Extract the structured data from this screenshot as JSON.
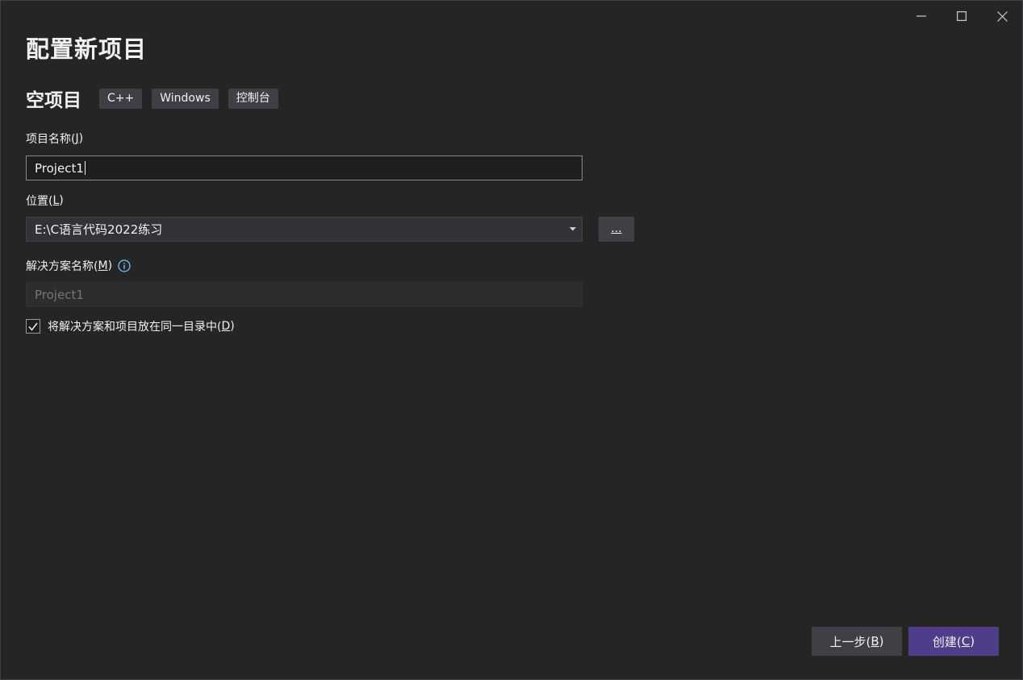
{
  "window": {
    "controls": {
      "minimize_icon": "minimize-icon",
      "maximize_icon": "maximize-icon",
      "close_icon": "close-icon"
    }
  },
  "header": {
    "title": "配置新项目"
  },
  "template": {
    "name": "空项目",
    "tags": [
      "C++",
      "Windows",
      "控制台"
    ]
  },
  "form": {
    "project_name": {
      "label": "项目名称(",
      "accesskey": "J",
      "label_end": ")",
      "value": "Project1"
    },
    "location": {
      "label": "位置(",
      "accesskey": "L",
      "label_end": ")",
      "value": "E:\\C语言代码2022练习",
      "browse_label": "..."
    },
    "solution_name": {
      "label": "解决方案名称(",
      "accesskey": "M",
      "label_end": ")",
      "placeholder": "Project1"
    },
    "same_dir": {
      "label": "将解决方案和项目放在同一目录中(",
      "accesskey": "D",
      "label_end": ")",
      "checked": true
    }
  },
  "footer": {
    "back": {
      "label": "上一步(",
      "accesskey": "B",
      "label_end": ")"
    },
    "create": {
      "label": "创建(",
      "accesskey": "C",
      "label_end": ")"
    }
  },
  "colors": {
    "background": "#252526",
    "accent": "#4f3d8a",
    "info_icon": "#75beff"
  }
}
